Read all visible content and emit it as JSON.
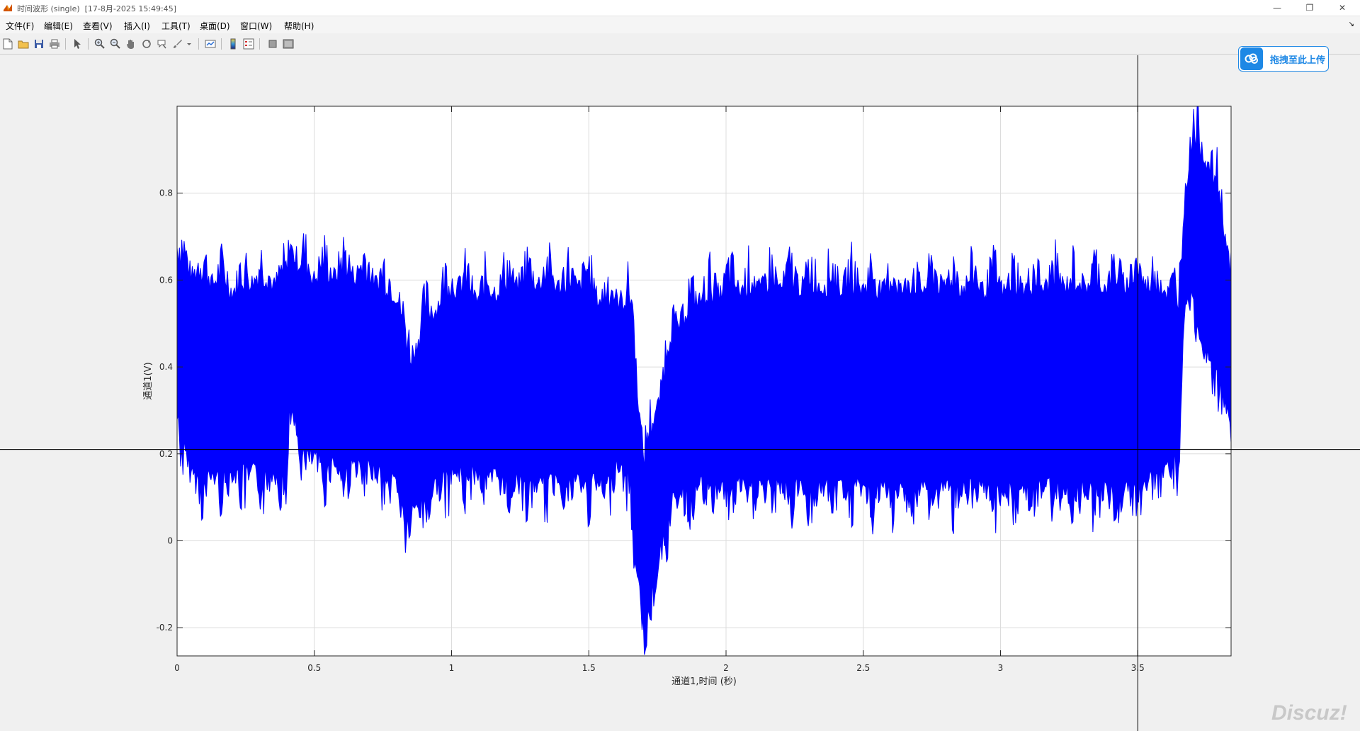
{
  "window": {
    "title": "时间波形 (single)  [17-8月-2025 15:49:45]",
    "minimize_glyph": "—",
    "maximize_glyph": "❐",
    "close_glyph": "✕"
  },
  "menu": {
    "items": [
      {
        "label": "文件(F)"
      },
      {
        "label": "编辑(E)"
      },
      {
        "label": "查看(V)"
      },
      {
        "label": "插入(I)"
      },
      {
        "label": "工具(T)"
      },
      {
        "label": "桌面(D)"
      },
      {
        "label": "窗口(W)"
      },
      {
        "label": "帮助(H)"
      }
    ],
    "corner_glyph": "↘"
  },
  "toolbar": {
    "icons": [
      "new-figure-icon",
      "open-file-icon",
      "save-icon",
      "print-icon",
      "select-arrow-icon",
      "zoom-in-icon",
      "zoom-out-icon",
      "pan-hand-icon",
      "rotate-3d-icon",
      "data-cursor-icon",
      "brush-icon",
      "link-plot-icon",
      "colorbar-icon",
      "legend-icon",
      "hide-plot-tools-icon",
      "show-plot-tools-icon"
    ]
  },
  "upload_button": {
    "label": "拖拽至此上传",
    "icon": "cloud-upload-icon",
    "color": "#1e88e5"
  },
  "watermark": "Discuz!",
  "chart_data": {
    "type": "line",
    "xlabel": "通道1,时间 (秒)",
    "ylabel": "通道1(V)",
    "xlim": [
      0,
      3.84
    ],
    "ylim": [
      -0.265,
      1.0
    ],
    "xticks": [
      0,
      0.5,
      1,
      1.5,
      2,
      2.5,
      3,
      3.5
    ],
    "xtick_labels": [
      "0",
      "0.5",
      "1",
      "1.5",
      "2",
      "2.5",
      "3",
      "3.5"
    ],
    "yticks": [
      -0.2,
      0,
      0.2,
      0.4,
      0.6,
      0.8
    ],
    "ytick_labels": [
      "-0.2",
      "0",
      "0.2",
      "0.4",
      "0.6",
      "0.8"
    ],
    "grid": true,
    "line_color": "#0000ff",
    "crosshair": {
      "x": 3.5,
      "y": 0.21
    },
    "series": [
      {
        "envelope_x": [
          0,
          0.02,
          0.05,
          0.1,
          0.2,
          0.3,
          0.4,
          0.41,
          0.42,
          0.45,
          0.5,
          0.6,
          0.7,
          0.75,
          0.8,
          0.83,
          0.85,
          0.9,
          1.0,
          1.1,
          1.2,
          1.3,
          1.4,
          1.5,
          1.55,
          1.6,
          1.65,
          1.66,
          1.68,
          1.7,
          1.72,
          1.75,
          1.78,
          1.8,
          1.85,
          1.9,
          2.0,
          2.2,
          2.4,
          2.6,
          2.8,
          3.0,
          3.2,
          3.4,
          3.5,
          3.6,
          3.65,
          3.67,
          3.7,
          3.75,
          3.8,
          3.84
        ],
        "upper": [
          0.71,
          0.69,
          0.67,
          0.66,
          0.63,
          0.66,
          0.63,
          0.74,
          0.72,
          0.68,
          0.66,
          0.67,
          0.66,
          0.64,
          0.62,
          0.51,
          0.47,
          0.55,
          0.64,
          0.61,
          0.64,
          0.65,
          0.64,
          0.64,
          0.6,
          0.61,
          0.59,
          0.57,
          0.38,
          0.23,
          0.28,
          0.36,
          0.46,
          0.53,
          0.57,
          0.61,
          0.63,
          0.64,
          0.64,
          0.63,
          0.64,
          0.63,
          0.64,
          0.64,
          0.65,
          0.63,
          0.6,
          0.84,
          0.99,
          0.93,
          0.83,
          0.67
        ],
        "lower": [
          0.25,
          0.18,
          0.1,
          0.09,
          0.1,
          0.1,
          0.1,
          0.27,
          0.22,
          0.17,
          0.13,
          0.12,
          0.11,
          0.1,
          0.08,
          0.01,
          0.0,
          0.05,
          0.1,
          0.1,
          0.09,
          0.07,
          0.09,
          0.08,
          0.07,
          0.12,
          0.1,
          -0.04,
          -0.15,
          -0.26,
          -0.19,
          -0.12,
          -0.02,
          0.03,
          0.06,
          0.07,
          0.07,
          0.07,
          0.07,
          0.06,
          0.07,
          0.06,
          0.07,
          0.06,
          0.06,
          0.12,
          0.15,
          0.48,
          0.5,
          0.37,
          0.3,
          0.2
        ]
      }
    ]
  }
}
